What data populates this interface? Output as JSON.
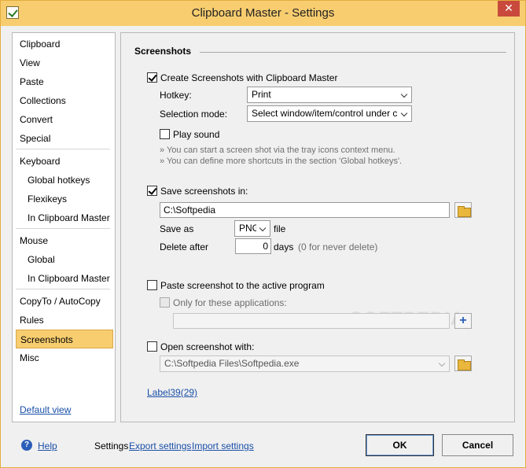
{
  "window": {
    "title": "Clipboard Master - Settings",
    "close_glyph": "✕"
  },
  "sidebar": {
    "items": [
      {
        "label": "Clipboard"
      },
      {
        "label": "View"
      },
      {
        "label": "Paste"
      },
      {
        "label": "Collections"
      },
      {
        "label": "Convert"
      },
      {
        "label": "Special"
      },
      {
        "label": "Keyboard"
      },
      {
        "label": "Global hotkeys"
      },
      {
        "label": "Flexikeys"
      },
      {
        "label": "In Clipboard Master"
      },
      {
        "label": "Mouse"
      },
      {
        "label": "Global"
      },
      {
        "label": "In Clipboard Master"
      },
      {
        "label": "CopyTo / AutoCopy"
      },
      {
        "label": "Rules"
      },
      {
        "label": "Screenshots",
        "active": true
      },
      {
        "label": "Misc"
      }
    ],
    "default_view": "Default view"
  },
  "main": {
    "section_title": "Screenshots",
    "create_label": "Create Screenshots with Clipboard Master",
    "create_checked": true,
    "hotkey_label": "Hotkey:",
    "hotkey_value": "Print",
    "selection_label": "Selection mode:",
    "selection_value": "Select window/item/control under cursor",
    "play_sound_label": "Play sound",
    "play_sound_checked": false,
    "hint1": "» You can start a screen shot via the tray icons context menu.",
    "hint2": "» You can define more shortcuts in the section 'Global hotkeys'.",
    "save_in_label": "Save screenshots in:",
    "save_in_checked": true,
    "save_path": "C:\\Softpedia",
    "save_as_label": "Save as",
    "format_value": "PNG",
    "file_label": "file",
    "delete_after_label": "Delete after",
    "delete_days": "0",
    "days_label": "days",
    "never_delete_hint": "(0 for never delete)",
    "paste_label": "Paste screenshot to the active program",
    "paste_checked": false,
    "only_apps_label": "Only for these applications:",
    "only_apps_value": "",
    "open_with_label": "Open screenshot with:",
    "open_with_checked": false,
    "open_with_path": "C:\\Softpedia Files\\Softpedia.exe",
    "label39": "Label39(29)",
    "watermark": "SOFTPEDIA"
  },
  "footer": {
    "help_glyph": "?",
    "help": "Help",
    "settings": "Settings",
    "export": "Export settings",
    "import": "Import settings",
    "ok": "OK",
    "cancel": "Cancel"
  },
  "colors": {
    "accent": "#f7cd6f",
    "link": "#1a4fa8"
  }
}
